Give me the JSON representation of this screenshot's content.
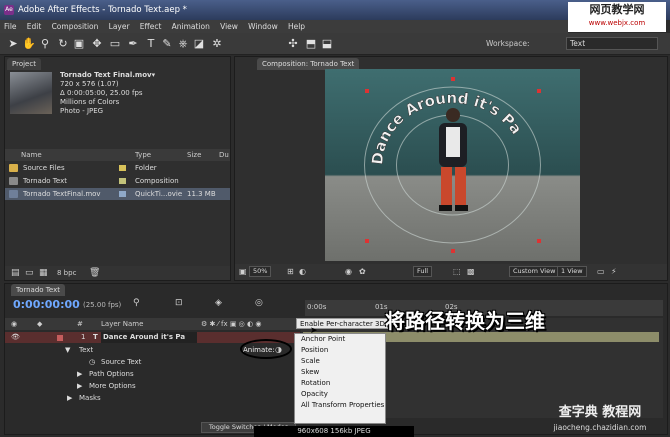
{
  "window": {
    "title": "Adobe After Effects - Tornado Text.aep *"
  },
  "watermark_top": {
    "cn": "网页教学网",
    "url": "www.webjx.com"
  },
  "menu": [
    "File",
    "Edit",
    "Composition",
    "Layer",
    "Effect",
    "Animation",
    "View",
    "Window",
    "Help"
  ],
  "toolbar": {
    "workspace_label": "Workspace:",
    "workspace_value": "Text"
  },
  "project": {
    "tab": "Project",
    "file_name": "Tornado Text Final.mov▾",
    "info_lines": [
      "720 x 576 (1.07)",
      "Δ 0:00:05:00, 25.00 fps",
      "Millions of Colors",
      "Photo - JPEG"
    ],
    "columns": [
      "Name",
      "Type",
      "Size",
      "Du"
    ],
    "items": [
      {
        "name": "Source Files",
        "type": "Folder",
        "size": "",
        "color": "#d8c25a"
      },
      {
        "name": "Tornado Text",
        "type": "Composition",
        "size": "",
        "color": "#c2c27a"
      },
      {
        "name": "Tornado TextFinal.mov",
        "type": "QuickTi...ovie",
        "size": "11.3 MB",
        "color": "#8fa9c9"
      }
    ],
    "bpc": "8 bpc"
  },
  "composition": {
    "tab": "Composition: Tornado Text",
    "zoom": "50%",
    "resolution": "Full",
    "camera": "Custom View 1",
    "views": "1 View"
  },
  "timeline": {
    "tab": "Tornado Text",
    "timecode": "0:00:00:00",
    "fps": "(25.00 fps)",
    "columns": {
      "num": "#",
      "layer_name": "Layer Name"
    },
    "layer_number": "1",
    "layer_name": "Dance Around it's Pa",
    "rows": {
      "text": "Text",
      "source_text": "Source Text",
      "path_options": "Path Options",
      "more_options": "More Options",
      "masks": "Masks"
    },
    "animate_label": "Animate:",
    "enable_item": "Enable Per-character 3D",
    "menu_items": [
      "Anchor Point",
      "Position",
      "Scale",
      "Skew",
      "Rotation",
      "Opacity",
      "All Transform Properties"
    ],
    "ruler": [
      "0:00s",
      "01s",
      "02s"
    ],
    "toggle_label": "Toggle Switches / Modes"
  },
  "overlay_text": "将路径转换为三维",
  "image_info": "960x608  156kb  JPEG",
  "watermark_bottom": {
    "cn": "查字典 教程网",
    "url": "jiaocheng.chazidian.com"
  }
}
